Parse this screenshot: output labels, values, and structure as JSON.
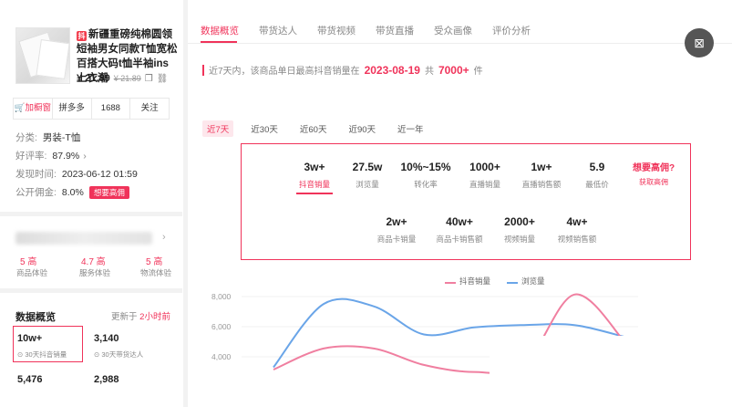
{
  "product": {
    "platform_badge": "抖",
    "title": "新疆重磅纯棉圆领短袖男女同款T恤宽松百搭大码t恤半袖ins上衣潮",
    "price": "¥ 21.89",
    "price_old": "¥ 21.89"
  },
  "actions": {
    "cart": "加橱窗",
    "pdd": "拼多多",
    "site": "1688",
    "follow": "关注"
  },
  "info": {
    "category_label": "分类:",
    "category_value": "男装-T恤",
    "rating_label": "好评率:",
    "rating_value": "87.9%",
    "publish_label": "发现时间:",
    "publish_value": "2023-06-12 01:59",
    "commission_label": "公开佣金:",
    "commission_value": "8.0%",
    "commission_tag": "想要高佣"
  },
  "scores": [
    {
      "value": "5 高",
      "label": "商品体验"
    },
    {
      "value": "4.7 高",
      "label": "服务体验"
    },
    {
      "value": "5 高",
      "label": "物流体验"
    }
  ],
  "overview": {
    "title": "数据概览",
    "updated_prefix": "更新于",
    "updated_value": "2小时前",
    "cards": [
      {
        "value": "10w+",
        "label": "30天抖音销量"
      },
      {
        "value": "3,140",
        "label": "30天带货达人"
      },
      {
        "value": "5,476",
        "label": ""
      },
      {
        "value": "2,988",
        "label": ""
      }
    ]
  },
  "tabs": [
    "数据概览",
    "带货达人",
    "带货视频",
    "带货直播",
    "受众画像",
    "评价分析"
  ],
  "notice": {
    "prefix": "近7天内，该商品单日最高抖音销量在",
    "date": "2023-08-19",
    "mid": "共",
    "count": "7000+",
    "suffix": "件"
  },
  "ranges": [
    "近7天",
    "近30天",
    "近60天",
    "近90天",
    "近一年"
  ],
  "metrics_row1": [
    {
      "value": "3w+",
      "label": "抖音销量"
    },
    {
      "value": "27.5w",
      "label": "浏览量"
    },
    {
      "value": "10%~15%",
      "label": "转化率"
    },
    {
      "value": "1000+",
      "label": "直播销量"
    },
    {
      "value": "1w+",
      "label": "直播销售额"
    },
    {
      "value": "5.9",
      "label": "最低价"
    }
  ],
  "metrics_row2": [
    {
      "value": "2w+",
      "label": "商品卡销量"
    },
    {
      "value": "40w+",
      "label": "商品卡销售额"
    },
    {
      "value": "2000+",
      "label": "视频销量"
    },
    {
      "value": "4w+",
      "label": "视频销售额"
    }
  ],
  "promo": {
    "title": "想要高佣?",
    "link": "获取高佣"
  },
  "colors": {
    "accent": "#f0335a",
    "series_sales": "#f07fa0",
    "series_views": "#6aa5e8"
  },
  "chart_data": {
    "type": "line",
    "legend": [
      "抖音销量",
      "浏览量"
    ],
    "legend_position": "top-center",
    "yticks": [
      "8,000",
      "6,000",
      "4,000"
    ],
    "ylim": [
      3200,
      9000
    ],
    "series": [
      {
        "name": "抖音销量",
        "values": [
          4600,
          5500,
          5500,
          4800,
          4500,
          4800,
          7800,
          5800
        ]
      },
      {
        "name": "浏览量",
        "values": [
          4700,
          7400,
          7300,
          6100,
          6400,
          6500,
          6500,
          6000
        ]
      }
    ]
  }
}
